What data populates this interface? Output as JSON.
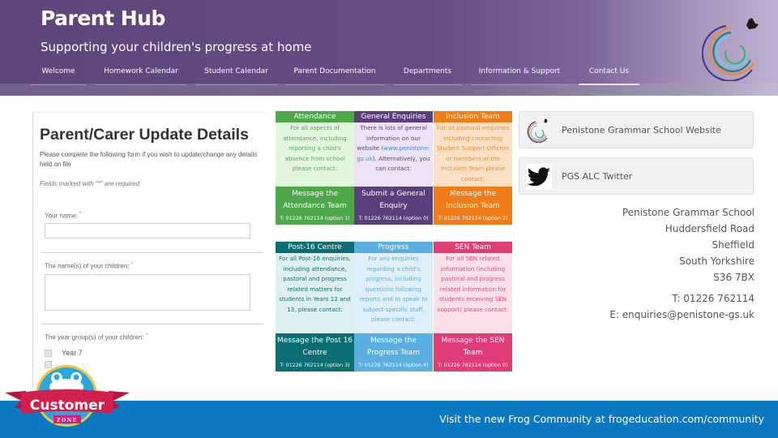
{
  "header": {
    "title": "Parent Hub",
    "subtitle": "Supporting your children's progress at home",
    "nav": [
      {
        "label": "Welcome",
        "active": false
      },
      {
        "label": "Homework Calendar",
        "active": false
      },
      {
        "label": "Student Calendar",
        "active": false
      },
      {
        "label": "Parent Documentation",
        "active": false
      },
      {
        "label": "Departments",
        "active": false
      },
      {
        "label": "Information & Support",
        "active": false
      },
      {
        "label": "Contact Us",
        "active": true
      }
    ],
    "logo_icon": "school-logo-icon"
  },
  "form": {
    "title": "Parent/Carer Update Details",
    "intro": "Please complete the following form if you wish to update/change any details held on file",
    "required_note": "Fields marked with \"*\" are required",
    "fields": [
      {
        "label": "Your name:",
        "required_mark": "*",
        "value": "",
        "placeholder": ""
      },
      {
        "label": "The name(s) of your children:",
        "required_mark": "*",
        "value": "",
        "placeholder": ""
      },
      {
        "label": "The year group(s) of your children:",
        "required_mark": "*"
      }
    ],
    "checkbox_options": [
      {
        "label": "Year 7",
        "checked": false
      },
      {
        "label": "",
        "checked": false
      }
    ]
  },
  "tiles": [
    {
      "heading": "Attendance",
      "body": "For all aspects of attendance, including reporting a child's absence from school please contact:",
      "action": "Message the Attendance Team",
      "phone": "T: 01226 762114 (option 1)",
      "colors": {
        "head": "#4ea84a",
        "body_bg": "#e3f7df",
        "body_text": "#5aa655",
        "action": "#4ea84a"
      }
    },
    {
      "heading": "General Enquiries",
      "body_pre": "There is lots of general information on our website (",
      "body_link": "www.penistone-gs.uk",
      "body_post": "). Alternatively, you can contact:",
      "action": "Submit a General Enquiry",
      "phone": "T: 01226 762114 (option 0)",
      "colors": {
        "head": "#5b3f7d",
        "body_bg": "#ede3f6",
        "body_text": "#5b3f7d",
        "link": "#2f8fcf",
        "action": "#5b3f7d"
      }
    },
    {
      "heading": "Inclusion Team",
      "body": "For all pastoral enquiries including contacting Student Support Officers or members of the Inclusion Team please contact:",
      "action": "Message the Inclusion Team",
      "phone": "T: 01226 762114 (option 2)",
      "colors": {
        "head": "#f07d1a",
        "body_bg": "#fde1c6",
        "body_text": "#ee8a2e",
        "action": "#f07d1a"
      }
    },
    {
      "heading": "Post-16 Centre",
      "body": "For all Post-16 enquiries, including attendance, pastoral and progress related matters for students in Years 12 and 13, please contact:",
      "action": "Message the Post 16 Centre",
      "phone": "T: 01226 762114 (option 3)",
      "colors": {
        "head": "#0a6e72",
        "body_bg": "#dcf0f1",
        "body_text": "#0f6e72",
        "action": "#0a6e72"
      }
    },
    {
      "heading": "Progress",
      "body": "For any enquiries regarding a child's progress, including questions following reports and to speak to subject-specific staff, please contact:",
      "action": "Message the Progress Team",
      "phone": "T: 01226 762114 (option 4)",
      "colors": {
        "head": "#5aaee0",
        "body_bg": "#dff0fa",
        "body_text": "#5aaee0",
        "action": "#5aaee0"
      }
    },
    {
      "heading": "SEN Team",
      "body": "For all SEN related information (including pastoral and progress related information for students receiving SEN support) please contact:",
      "action": "Message the SEN Team",
      "phone": "T: 01226 762114 (option 0)",
      "colors": {
        "head": "#e03c77",
        "body_bg": "#fbe0ea",
        "body_text": "#e04a80",
        "action": "#e03c77"
      }
    }
  ],
  "links": [
    {
      "label": "Penistone Grammar School Website",
      "icon": "school-logo-icon"
    },
    {
      "label": "PGS ALC Twitter",
      "icon": "twitter-bird-icon"
    }
  ],
  "address": {
    "lines": [
      "Penistone Grammar School",
      "Huddersfield Road",
      "Sheffield",
      "South Yorkshire",
      "S36 7BX"
    ],
    "phone": "T: 01226 762114",
    "email": "E: enquiries@penistone-gs.uk"
  },
  "badge": {
    "title": "Customer",
    "subtitle": "ZONE",
    "icon": "frog-icon"
  },
  "footer": {
    "text": "Visit the new Frog Community at frogeducation.com/community",
    "color": "#0a78c2"
  }
}
